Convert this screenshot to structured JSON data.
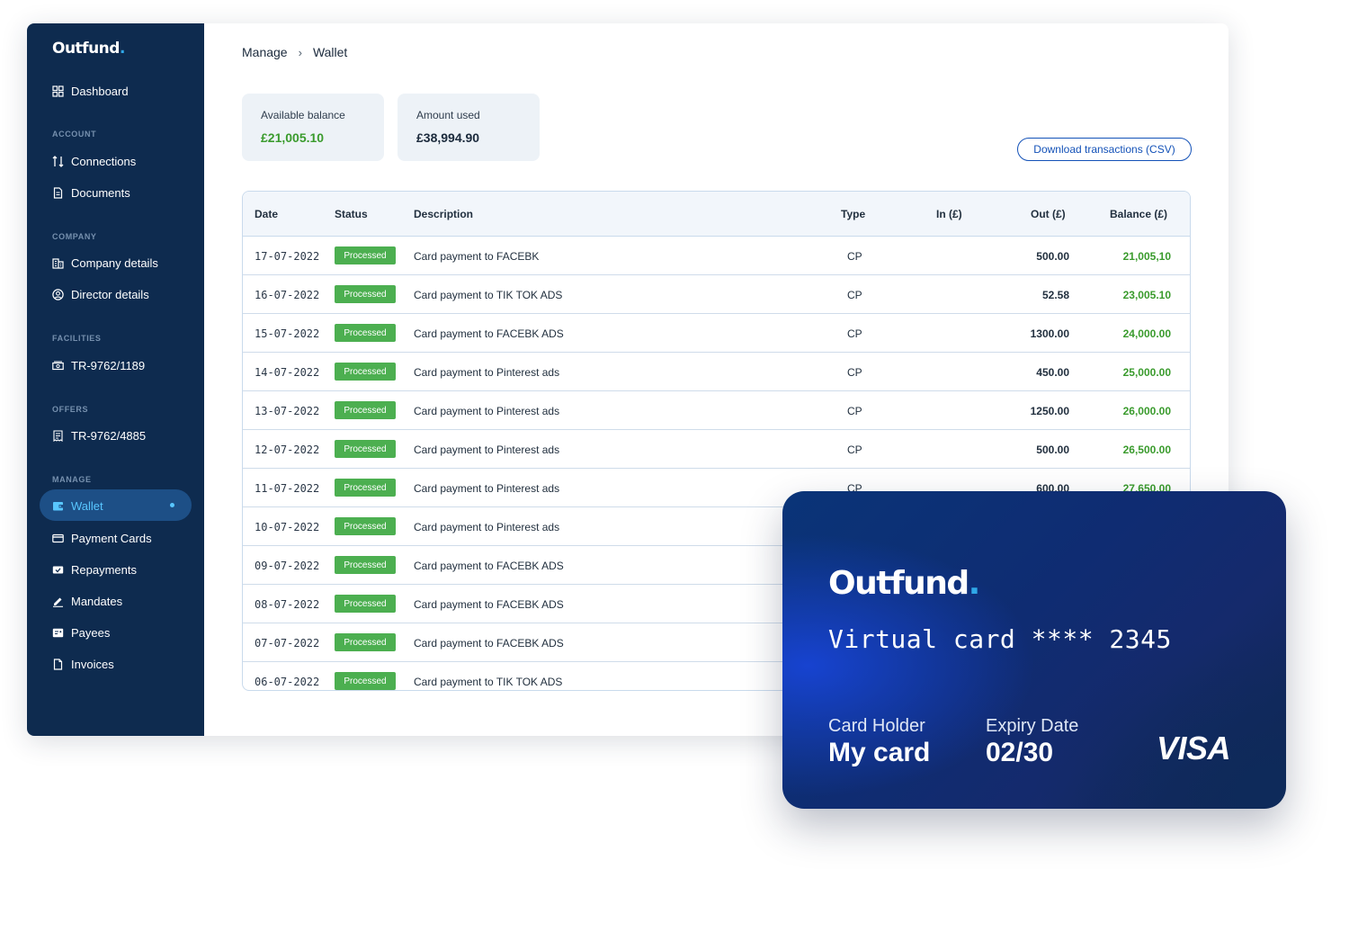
{
  "brand": {
    "name": "Outfund",
    "dot": "."
  },
  "sidebar": {
    "dashboard": "Dashboard",
    "sections": {
      "account": "ACCOUNT",
      "company": "COMPANY",
      "facilities": "FACILITIES",
      "offers": "OFFERS",
      "manage": "MANAGE"
    },
    "items": {
      "connections": "Connections",
      "documents": "Documents",
      "company_details": "Company details",
      "director_details": "Director details",
      "facility": "TR-9762/1189",
      "offer": "TR-9762/4885",
      "wallet": "Wallet",
      "payment_cards": "Payment Cards",
      "repayments": "Repayments",
      "mandates": "Mandates",
      "payees": "Payees",
      "invoices": "Invoices"
    },
    "active_item": "Wallet"
  },
  "breadcrumb": {
    "parent": "Manage",
    "separator": "›",
    "current": "Wallet"
  },
  "stats": {
    "available_label": "Available balance",
    "available_value": "£21,005.10",
    "used_label": "Amount used",
    "used_value": "£38,994.90"
  },
  "download_button": "Download transactions (CSV)",
  "table": {
    "headers": {
      "date": "Date",
      "status": "Status",
      "description": "Description",
      "type": "Type",
      "in": "In (£)",
      "out": "Out (£)",
      "balance": "Balance (£)"
    },
    "rows": [
      {
        "date": "17-07-2022",
        "status": "Processed",
        "description": "Card payment to FACEBK",
        "type": "CP",
        "in": "",
        "out": "500.00",
        "balance": "21,005,10"
      },
      {
        "date": "16-07-2022",
        "status": "Processed",
        "description": "Card payment to TIK TOK ADS",
        "type": "CP",
        "in": "",
        "out": "52.58",
        "balance": "23,005.10"
      },
      {
        "date": "15-07-2022",
        "status": "Processed",
        "description": "Card payment to FACEBK ADS",
        "type": "CP",
        "in": "",
        "out": "1300.00",
        "balance": "24,000.00"
      },
      {
        "date": "14-07-2022",
        "status": "Processed",
        "description": "Card payment to Pinterest ads",
        "type": "CP",
        "in": "",
        "out": "450.00",
        "balance": "25,000.00"
      },
      {
        "date": "13-07-2022",
        "status": "Processed",
        "description": "Card payment to Pinterest ads",
        "type": "CP",
        "in": "",
        "out": "1250.00",
        "balance": "26,000.00"
      },
      {
        "date": "12-07-2022",
        "status": "Processed",
        "description": "Card payment to Pinterest ads",
        "type": "CP",
        "in": "",
        "out": "500.00",
        "balance": "26,500.00"
      },
      {
        "date": "11-07-2022",
        "status": "Processed",
        "description": "Card payment to Pinterest ads",
        "type": "CP",
        "in": "",
        "out": "600.00",
        "balance": "27,650.00"
      },
      {
        "date": "10-07-2022",
        "status": "Processed",
        "description": "Card payment to Pinterest ads",
        "type": "",
        "in": "",
        "out": "",
        "balance": ""
      },
      {
        "date": "09-07-2022",
        "status": "Processed",
        "description": "Card payment to FACEBK ADS",
        "type": "",
        "in": "",
        "out": "",
        "balance": ""
      },
      {
        "date": "08-07-2022",
        "status": "Processed",
        "description": "Card payment to FACEBK ADS",
        "type": "",
        "in": "",
        "out": "",
        "balance": ""
      },
      {
        "date": "07-07-2022",
        "status": "Processed",
        "description": "Card payment to FACEBK ADS",
        "type": "",
        "in": "",
        "out": "",
        "balance": ""
      },
      {
        "date": "06-07-2022",
        "status": "Processed",
        "description": "Card payment to TIK TOK ADS",
        "type": "",
        "in": "",
        "out": "",
        "balance": ""
      }
    ]
  },
  "virtual_card": {
    "brand": "Outfund",
    "number": "Virtual card **** 2345",
    "holder_label": "Card Holder",
    "holder_value": "My card",
    "expiry_label": "Expiry Date",
    "expiry_value": "02/30",
    "network": "VISA"
  },
  "colors": {
    "sidebar_bg": "#0e2b4f",
    "active_nav": "#1d4f86",
    "accent_cyan": "#58c6ff",
    "status_green": "#4caf50",
    "balance_green": "#3a9b2d",
    "link_blue": "#1452b8"
  },
  "icons": {
    "dashboard": "grid-icon",
    "connections": "connections-icon",
    "documents": "document-icon",
    "company_details": "building-icon",
    "director_details": "user-circle-icon",
    "facility": "banknote-icon",
    "offer": "receipt-icon",
    "wallet": "wallet-icon",
    "payment_cards": "credit-card-icon",
    "repayments": "repayment-icon",
    "mandates": "pen-icon",
    "payees": "payee-icon",
    "invoices": "invoice-icon"
  }
}
